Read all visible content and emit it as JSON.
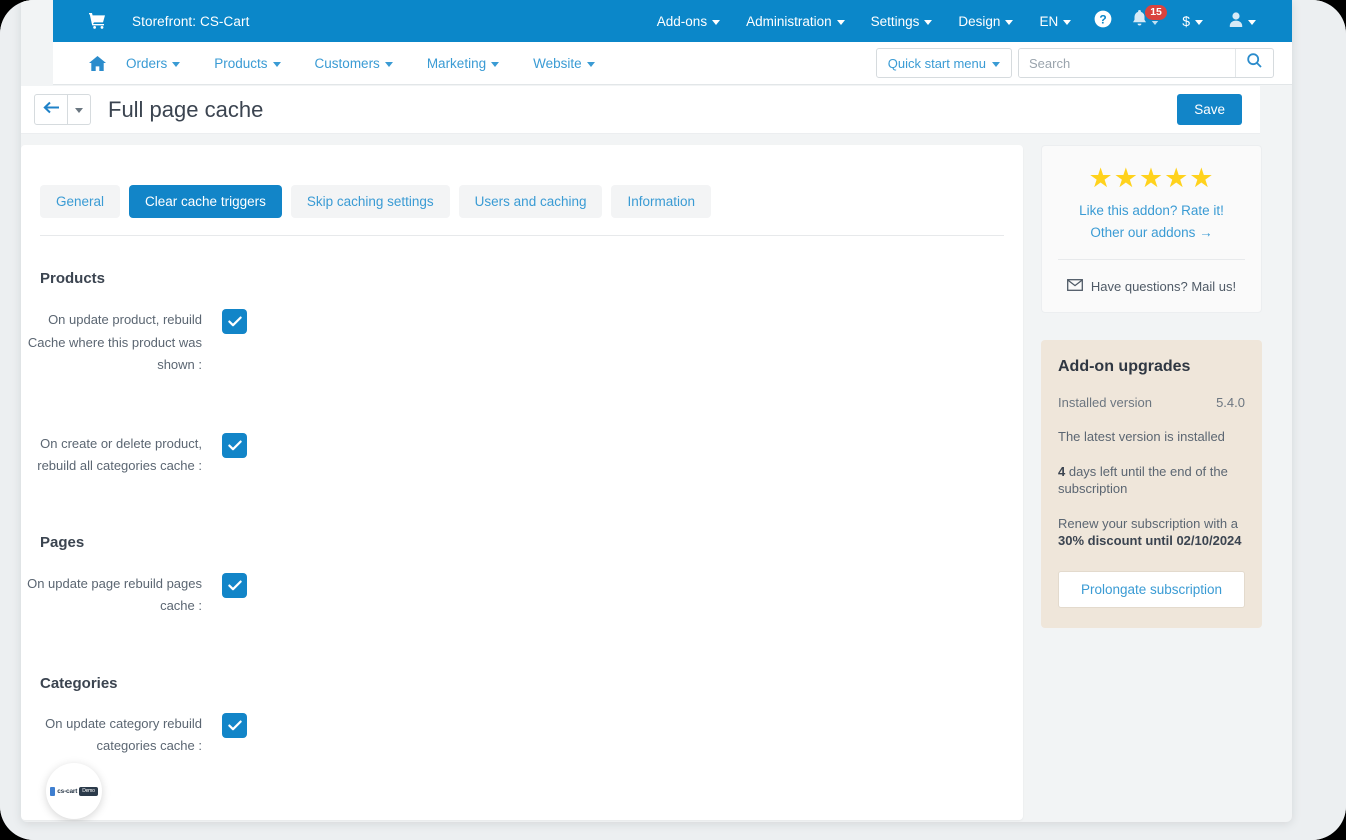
{
  "topbar": {
    "cart_icon": "shopping-cart-icon",
    "brand": "Storefront: CS-Cart",
    "menu": [
      {
        "label": "Add-ons",
        "caret": true
      },
      {
        "label": "Administration",
        "caret": true
      },
      {
        "label": "Settings",
        "caret": true
      },
      {
        "label": "Design",
        "caret": true
      },
      {
        "label": "EN",
        "caret": true
      }
    ],
    "help_icon": "question-circle-icon",
    "bell_icon": "bell-icon",
    "notification_count": "15",
    "currency_symbol": "$",
    "user_icon": "user-icon",
    "bg_color": "#0b87c9"
  },
  "subnav": {
    "home_icon": "home-icon",
    "items": [
      {
        "label": "Orders"
      },
      {
        "label": "Products"
      },
      {
        "label": "Customers"
      },
      {
        "label": "Marketing"
      },
      {
        "label": "Website"
      }
    ],
    "quick_start_label": "Quick start menu",
    "search_placeholder": "Search",
    "search_value": "",
    "search_icon": "search-icon"
  },
  "titlebar": {
    "back_icon": "arrow-left-icon",
    "back_caret_icon": "chevron-down-icon",
    "title": "Full page cache",
    "save_label": "Save"
  },
  "tabs": [
    {
      "label": "General",
      "active": false
    },
    {
      "label": "Clear cache triggers",
      "active": true
    },
    {
      "label": "Skip caching settings",
      "active": false
    },
    {
      "label": "Users and caching",
      "active": false
    },
    {
      "label": "Information",
      "active": false
    }
  ],
  "sections": [
    {
      "title": "Products",
      "fields": [
        {
          "label": "On update product, rebuild Cache where this product was shown :",
          "checked": true
        },
        {
          "label": "On create or delete product, rebuild all categories cache :",
          "checked": true
        }
      ]
    },
    {
      "title": "Pages",
      "fields": [
        {
          "label": "On update page rebuild pages cache :",
          "checked": true
        }
      ]
    },
    {
      "title": "Categories",
      "fields": [
        {
          "label": "On update category rebuild categories cache :",
          "checked": true
        }
      ]
    }
  ],
  "sidebar": {
    "rate_card": {
      "stars": "★★★★★",
      "star_color": "#ffd21c",
      "rate_link": "Like this addon? Rate it!",
      "other_addons_link": "Other our addons →",
      "mail_icon": "envelope-icon",
      "mail_label": "Have questions? Mail us!"
    },
    "upgrade_card": {
      "title": "Add-on upgrades",
      "installed_version_label": "Installed version",
      "installed_version_value": "5.4.0",
      "latest_text": "The latest version is installed",
      "days_left_number": "4",
      "days_left_text": " days left until the end of the subscription",
      "renew_text": "Renew your subscription with a ",
      "renew_bold": "30% discount until 02/10/2024",
      "prolongate_label": "Prolongate subscription",
      "bg_color": "#efe6da"
    }
  },
  "chat_widget": {
    "icon": "cs-cart-logo-icon",
    "word": "cs-cart",
    "pill": "Demo"
  }
}
